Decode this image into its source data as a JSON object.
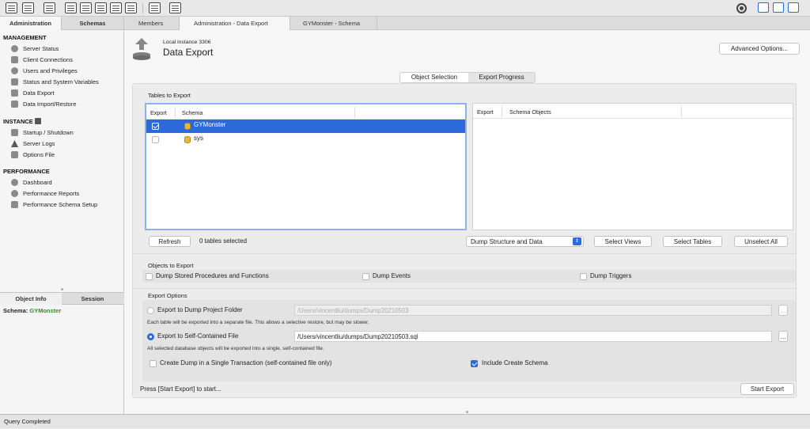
{
  "tabs": {
    "administration": "Administration",
    "schemas": "Schemas",
    "members": "Members",
    "admin_export": "Administration - Data Export",
    "schema_tab": "GYMonster - Schema"
  },
  "sidebar": {
    "management_title": "MANAGEMENT",
    "management": [
      "Server Status",
      "Client Connections",
      "Users and Privileges",
      "Status and System Variables",
      "Data Export",
      "Data Import/Restore"
    ],
    "instance_title": "INSTANCE",
    "instance": [
      "Startup / Shutdown",
      "Server Logs",
      "Options File"
    ],
    "performance_title": "PERFORMANCE",
    "performance": [
      "Dashboard",
      "Performance Reports",
      "Performance Schema Setup"
    ]
  },
  "info": {
    "object_info": "Object Info",
    "session": "Session",
    "schema_label": "Schema:",
    "schema_value": "GYMonster"
  },
  "header": {
    "subtitle": "Local instance 3306",
    "title": "Data Export",
    "advanced": "Advanced Options..."
  },
  "segments": {
    "object_selection": "Object Selection",
    "export_progress": "Export Progress"
  },
  "tables": {
    "section": "Tables to Export",
    "left_cols": [
      "Export",
      "Schema"
    ],
    "rows": [
      {
        "name": "GYMonster",
        "checked": true
      },
      {
        "name": "sys",
        "checked": false
      }
    ],
    "right_cols": [
      "Export",
      "Schema Objects"
    ],
    "refresh": "Refresh",
    "selected_count": "0 tables selected",
    "dump_mode": "Dump Structure and Data",
    "select_views": "Select Views",
    "select_tables": "Select Tables",
    "unselect_all": "Unselect All"
  },
  "objects": {
    "section": "Objects to Export",
    "procs": "Dump Stored Procedures and Functions",
    "events": "Dump Events",
    "triggers": "Dump Triggers"
  },
  "options": {
    "section": "Export Options",
    "folder_label": "Export to Dump Project Folder",
    "folder_path": "/Users/vincentliu/dumps/Dump20210503",
    "folder_note": "Each table will be exported into a separate file. This allows a selective restore, but may be slower.",
    "file_label": "Export to Self-Contained File",
    "file_path": "/Users/vincentliu/dumps/Dump20210503.sql",
    "file_note": "All selected database objects will be exported into a single, self-contained file.",
    "single_txn": "Create Dump in a Single Transaction (self-contained file only)",
    "include_schema": "Include Create Schema",
    "browse": "..."
  },
  "footer": {
    "hint": "Press [Start Export] to start...",
    "start": "Start Export"
  },
  "status": "Query Completed",
  "colors": {
    "accent": "#2d6ad9",
    "schema_green": "#2f8f2f",
    "selection": "#2d6ad9"
  }
}
